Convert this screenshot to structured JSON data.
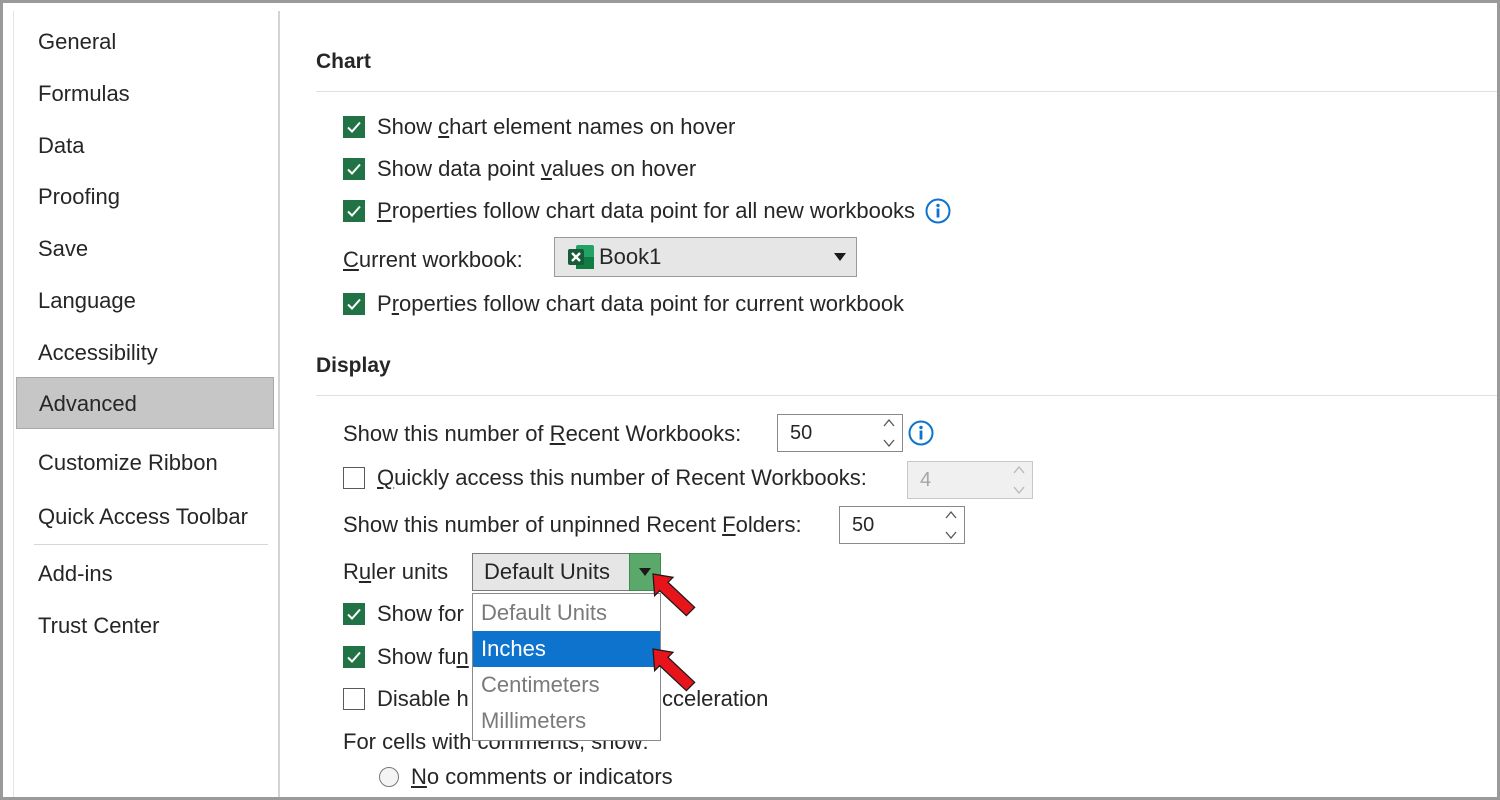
{
  "sidebar": {
    "items": [
      {
        "label": "General"
      },
      {
        "label": "Formulas"
      },
      {
        "label": "Data"
      },
      {
        "label": "Proofing"
      },
      {
        "label": "Save"
      },
      {
        "label": "Language"
      },
      {
        "label": "Accessibility"
      },
      {
        "label": "Advanced",
        "active": true
      },
      {
        "label": "Customize Ribbon"
      },
      {
        "label": "Quick Access Toolbar"
      },
      {
        "label": "Add-ins"
      },
      {
        "label": "Trust Center"
      }
    ]
  },
  "chart": {
    "title": "Chart",
    "show_names_pre": "Show ",
    "show_names_u": "c",
    "show_names_post": "hart element names on hover",
    "show_values_pre": "Show data point ",
    "show_values_u": "v",
    "show_values_post": "alues on hover",
    "props_all_u": "P",
    "props_all_post": "roperties follow chart data point for all new workbooks",
    "current_wb_u": "C",
    "current_wb_post": "urrent workbook:",
    "current_wb_value": "Book1",
    "props_current_pre": "P",
    "props_current_u": "r",
    "props_current_post": "operties follow chart data point for current workbook"
  },
  "display": {
    "title": "Display",
    "recent_wb_pre": "Show this number of ",
    "recent_wb_u": "R",
    "recent_wb_post": "ecent Workbooks:",
    "recent_wb_value": "50",
    "quick_access_u": "Q",
    "quick_access_post": "uickly access this number of Recent Workbooks:",
    "quick_access_value": "4",
    "folders_pre": "Show this number of unpinned Recent ",
    "folders_u": "F",
    "folders_post": "olders:",
    "folders_value": "50",
    "ruler_pre": "R",
    "ruler_u": "u",
    "ruler_post": "ler units",
    "ruler_value": "Default Units",
    "ruler_options": [
      "Default Units",
      "Inches",
      "Centimeters",
      "Millimeters"
    ],
    "show_formula_bar_visible": "Show for",
    "show_function_visible": "Show fu",
    "function_u": "n",
    "disable_hw_visible": "Disable h",
    "disable_hw_tail": "cceleration",
    "comments_label": "For cells with comments, show:",
    "no_comments_u": "N",
    "no_comments_post": "o comments or indicators"
  },
  "colors": {
    "checkbox_accent": "#217346",
    "ruler_button": "#5ba86b",
    "dropdown_highlight": "#0e73cc",
    "info_icon": "#0e73cc",
    "annotation_arrow": "#e8141b"
  }
}
